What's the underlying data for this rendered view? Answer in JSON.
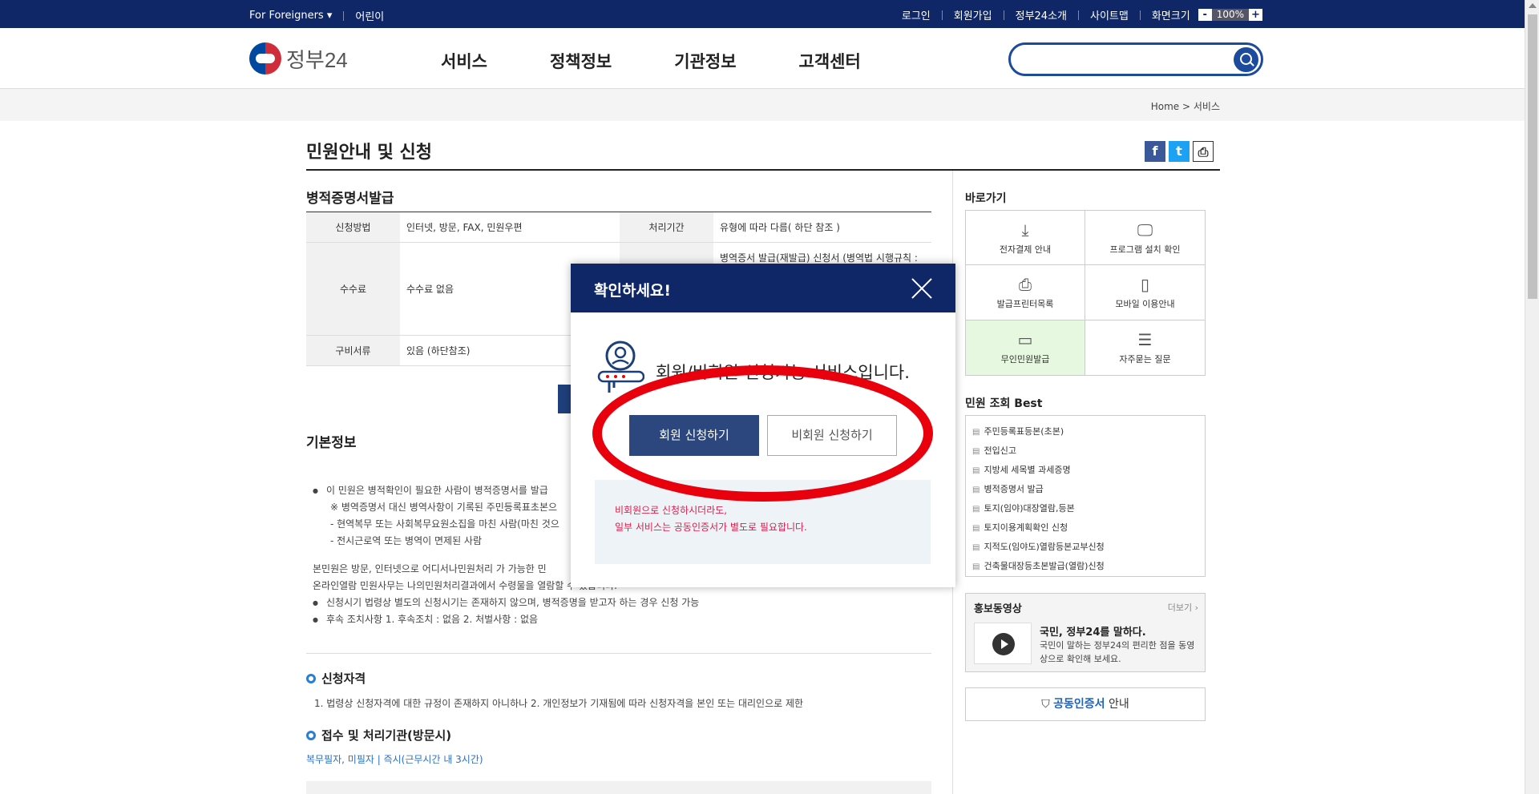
{
  "util_bar": {
    "left_links": [
      "For Foreigners ▾",
      "어린이"
    ],
    "right_links": [
      "로그인",
      "회원가입",
      "정부24소개",
      "사이트맵",
      "화면크기"
    ],
    "zoom_minus": "-",
    "zoom_value": "100%",
    "zoom_plus": "+"
  },
  "header": {
    "logo_text": "정부24",
    "nav": [
      "서비스",
      "정책정보",
      "기관정보",
      "고객센터"
    ],
    "search_placeholder": ""
  },
  "breadcrumb": {
    "home": "Home",
    "sep": ">",
    "current": "서비스"
  },
  "main": {
    "page_title": "민원안내 및 신청",
    "sub_title": "병적증명서발급",
    "table": {
      "row1": {
        "h1": "신청방법",
        "v1": "인터넷, 방문, FAX, 민원우편",
        "h2": "처리기간",
        "v2": "유형에 따라 다름( 하단 참조 )"
      },
      "row2": {
        "h1": "수수료",
        "v1": "수수료 없음",
        "v2": "병역증서 발급(재발급) 신청서 (병역법 시행규칙 :"
      },
      "row3": {
        "h1": "구비서류",
        "v1": "있음 (하단참조)"
      }
    },
    "basic_title": "기본정보",
    "basic_lines": [
      "이 민원은 병적확인이 필요한 사람이 병적증명서를 발급",
      "※ 병역증명서 대신 병역사항이 기록된 주민등록표초본으",
      "- 현역복무 또는 사회복무요원소집을 마친 사람(마친 것으",
      "- 전시근로역 또는 병역이 면제된 사람",
      "본민원은 방문, 인터넷으로 어디서나민원처리 가 가능한 민",
      "온라인열람 민원사무는 나의민원처리결과에서 수령물을 열람할 수 있습니다.",
      "신청시기 법령상 별도의 신청시기는 존재하지 않으며, 병적증명을 받고자 하는 경우 신청 가능",
      "후속 조치사항 1. 후속조치 : 없음 2. 처벌사항 : 없음"
    ],
    "qualification_title": "신청자격",
    "qualification_text": "1. 법령상 신청자격에 대한 규정이 존재하지 아니하나 2. 개인정보가 기재됨에 따라 신청자격을 본인 또는 대리인으로 제한",
    "office_title": "접수 및 처리기관(방문시)",
    "office_text": "복무필자, 미필자 | 즉시(근무시간 내 3시간)",
    "share": {
      "facebook": "f",
      "twitter": "t",
      "print": "⎙"
    }
  },
  "sidebar": {
    "quick_title": "바로가기",
    "quick_items": [
      {
        "label": "전자결제 안내",
        "icon": "⤓"
      },
      {
        "label": "프로그램 설치 확인",
        "icon": "🖵"
      },
      {
        "label": "발급프린터목록",
        "icon": "⎙"
      },
      {
        "label": "모바일 이용안내",
        "icon": "▯"
      },
      {
        "label": "무인민원발급",
        "icon": "▭"
      },
      {
        "label": "자주묻는 질문",
        "icon": "☰"
      }
    ],
    "best_title": "민원 조회 Best",
    "best_items": [
      "주민등록표등본(초본)",
      "전입신고",
      "지방세 세목별 과세증명",
      "병적증명서 발급",
      "토지(임야)대장열람,등본",
      "토지이용계획확인 신청",
      "지적도(임야도)열람등본교부신청",
      "건축물대장등초본발급(열람)신청"
    ],
    "promo_title": "홍보동영상",
    "promo_more": "더보기 ›",
    "promo_headline": "국민, 정부24를 말하다.",
    "promo_desc": "국민이 말하는 정부24의 편리한 점을 동영상으로 확인해 보세요.",
    "cert_blue": "공동인증서",
    "cert_rest": " 안내"
  },
  "modal": {
    "title": "확인하세요!",
    "message": "회원/비회원 신청가능 서비스입니다.",
    "member_button": "회원 신청하기",
    "guest_button": "비회원 신청하기",
    "notice_line1": "비회원으로 신청하시더라도,",
    "notice_line2": "일부 서비스는 공동인증서가 별도로 필요합니다."
  },
  "colors": {
    "navy": "#0f2766",
    "button_navy": "#2c477e",
    "annotation_red": "#e8000c",
    "notice_red": "#d8224c"
  }
}
